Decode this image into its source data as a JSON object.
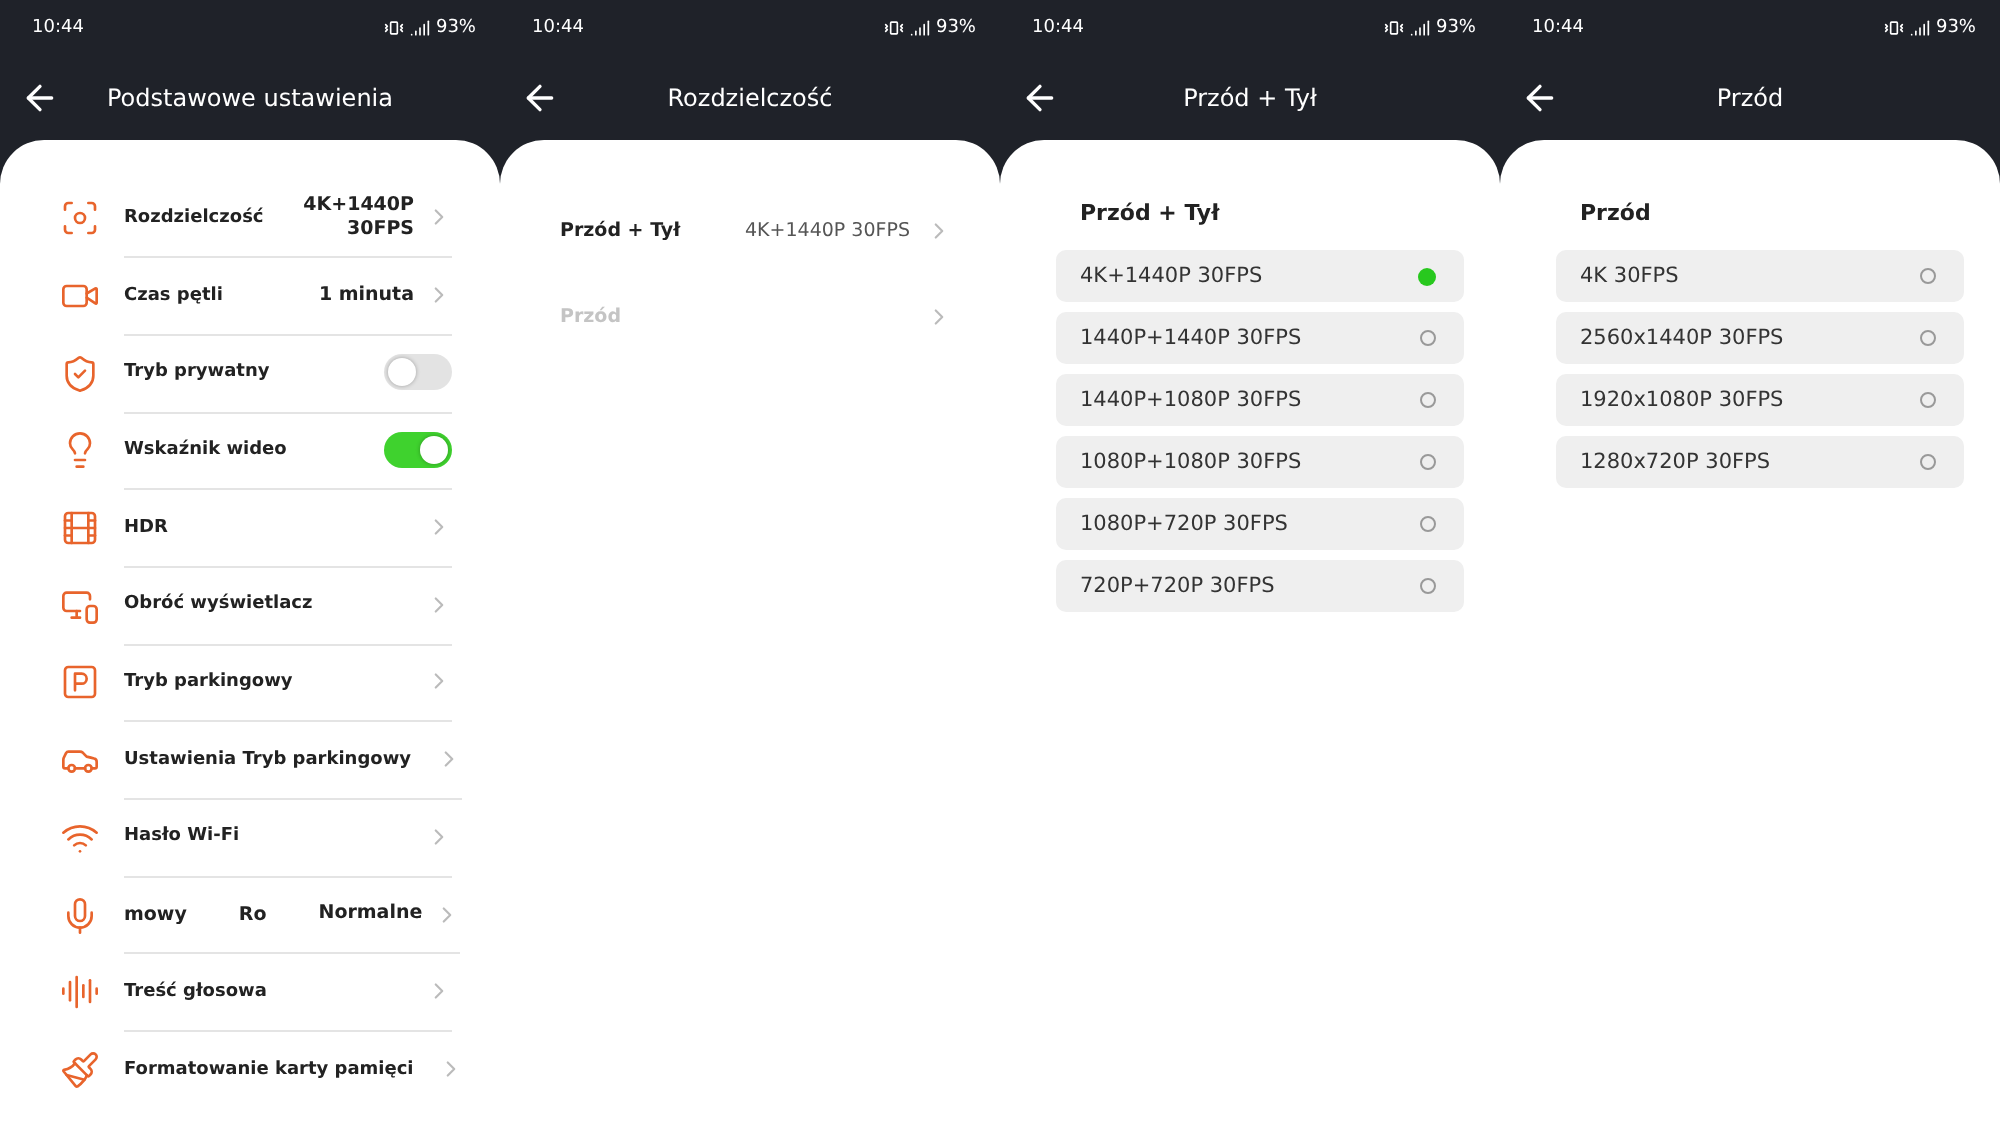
{
  "screens": [
    {
      "kind": "settings",
      "status_bar": {
        "time": "10:44",
        "battery": "93%"
      },
      "title": "Podstawowe ustawienia",
      "items": [
        {
          "kind": "link",
          "label": "Rozdzielczość",
          "value": "4K+1440P\n30FPS"
        },
        {
          "kind": "link",
          "label": "Czas pętli",
          "value": "1 minuta"
        },
        {
          "kind": "toggle",
          "label": "Tryb prywatny",
          "on": false
        },
        {
          "kind": "toggle",
          "label": "Wskaźnik wideo",
          "on": true
        },
        {
          "kind": "link",
          "label": "HDR"
        },
        {
          "kind": "link",
          "label": "Obróć wyświetlacz"
        },
        {
          "kind": "link",
          "label": "Tryb parkingowy"
        },
        {
          "kind": "link",
          "label": "Ustawienia Tryb parkingowy"
        },
        {
          "kind": "link",
          "label": "Hasło Wi-Fi"
        },
        {
          "kind": "link",
          "label_fragments": [
            "mowy",
            "Ro"
          ],
          "value": "Normalne"
        },
        {
          "kind": "link",
          "label": "Treść głosowa"
        },
        {
          "kind": "link",
          "label": "Formatowanie karty pamięci"
        }
      ]
    },
    {
      "kind": "menu",
      "status_bar": {
        "time": "10:44",
        "battery": "93%"
      },
      "title": "Rozdzielczość",
      "items": [
        {
          "label": "Przód + Tył",
          "value": "4K+1440P 30FPS",
          "disabled": false
        },
        {
          "label": "Przód",
          "disabled": true
        }
      ]
    },
    {
      "kind": "options",
      "status_bar": {
        "time": "10:44",
        "battery": "93%"
      },
      "title": "Przód + Tył",
      "heading": "Przód + Tył",
      "options": [
        {
          "label": "4K+1440P 30FPS",
          "selected": true
        },
        {
          "label": "1440P+1440P 30FPS",
          "selected": false
        },
        {
          "label": "1440P+1080P 30FPS",
          "selected": false
        },
        {
          "label": "1080P+1080P 30FPS",
          "selected": false
        },
        {
          "label": "1080P+720P 30FPS",
          "selected": false
        },
        {
          "label": "720P+720P 30FPS",
          "selected": false
        }
      ]
    },
    {
      "kind": "options",
      "status_bar": {
        "time": "10:44",
        "battery": "93%"
      },
      "title": "Przód",
      "heading": "Przód",
      "options": [
        {
          "label": "4K 30FPS",
          "selected": false
        },
        {
          "label": "2560x1440P 30FPS",
          "selected": false
        },
        {
          "label": "1920x1080P 30FPS",
          "selected": false
        },
        {
          "label": "1280x720P 30FPS",
          "selected": false
        }
      ]
    }
  ]
}
